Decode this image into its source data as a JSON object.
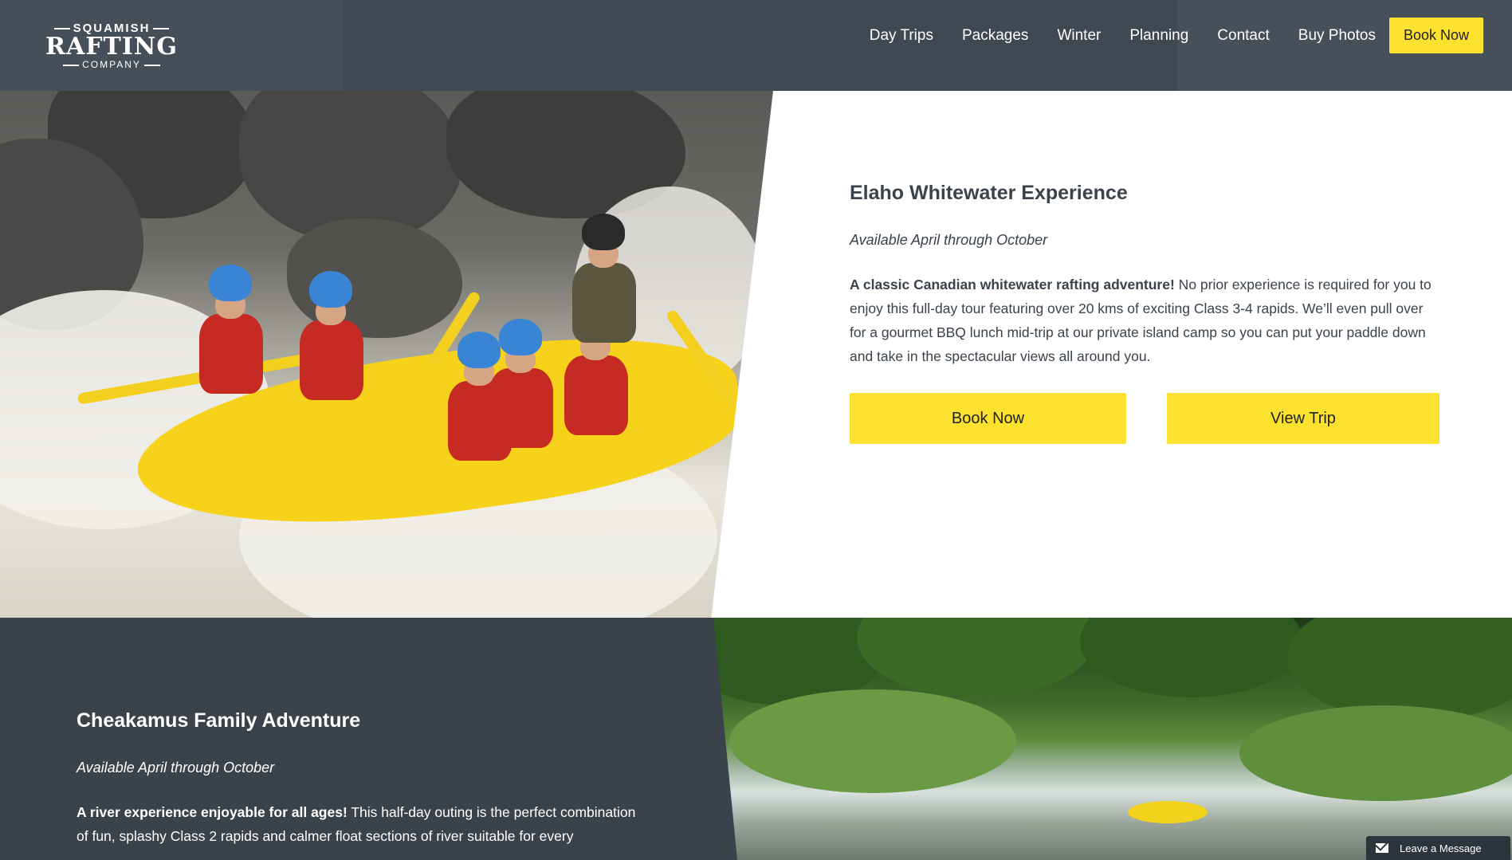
{
  "logo": {
    "line1": "SQUAMISH",
    "line2": "RAFTING",
    "line3": "COMPANY"
  },
  "nav": {
    "items": [
      "Day Trips",
      "Packages",
      "Winter",
      "Planning",
      "Contact",
      "Buy Photos"
    ],
    "book_label": "Book Now"
  },
  "trip1": {
    "title": "Elaho Whitewater Experience",
    "availability": "Available April through October",
    "lead": "A classic Canadian whitewater rafting adventure!",
    "body": " No prior experience is required for you to enjoy this full-day tour featuring over 20 kms of exciting Class 3-4 rapids. We’ll even pull over for a gourmet BBQ lunch mid-trip at our private island camp so you can put your paddle down and take in the spectacular views all around you.",
    "book_label": "Book Now",
    "view_label": "View Trip"
  },
  "trip2": {
    "title": "Cheakamus Family Adventure",
    "availability": "Available April through October",
    "lead": "A river experience enjoyable for all ages!",
    "body": " This half-day outing is the perfect combination of fun, splashy Class 2 rapids and calmer float sections of river suitable for every"
  },
  "chat": {
    "label": "Leave a Message"
  },
  "colors": {
    "header_bg": "#3e4954",
    "accent_yellow": "#fde12f",
    "dark_section": "#3a424b"
  }
}
